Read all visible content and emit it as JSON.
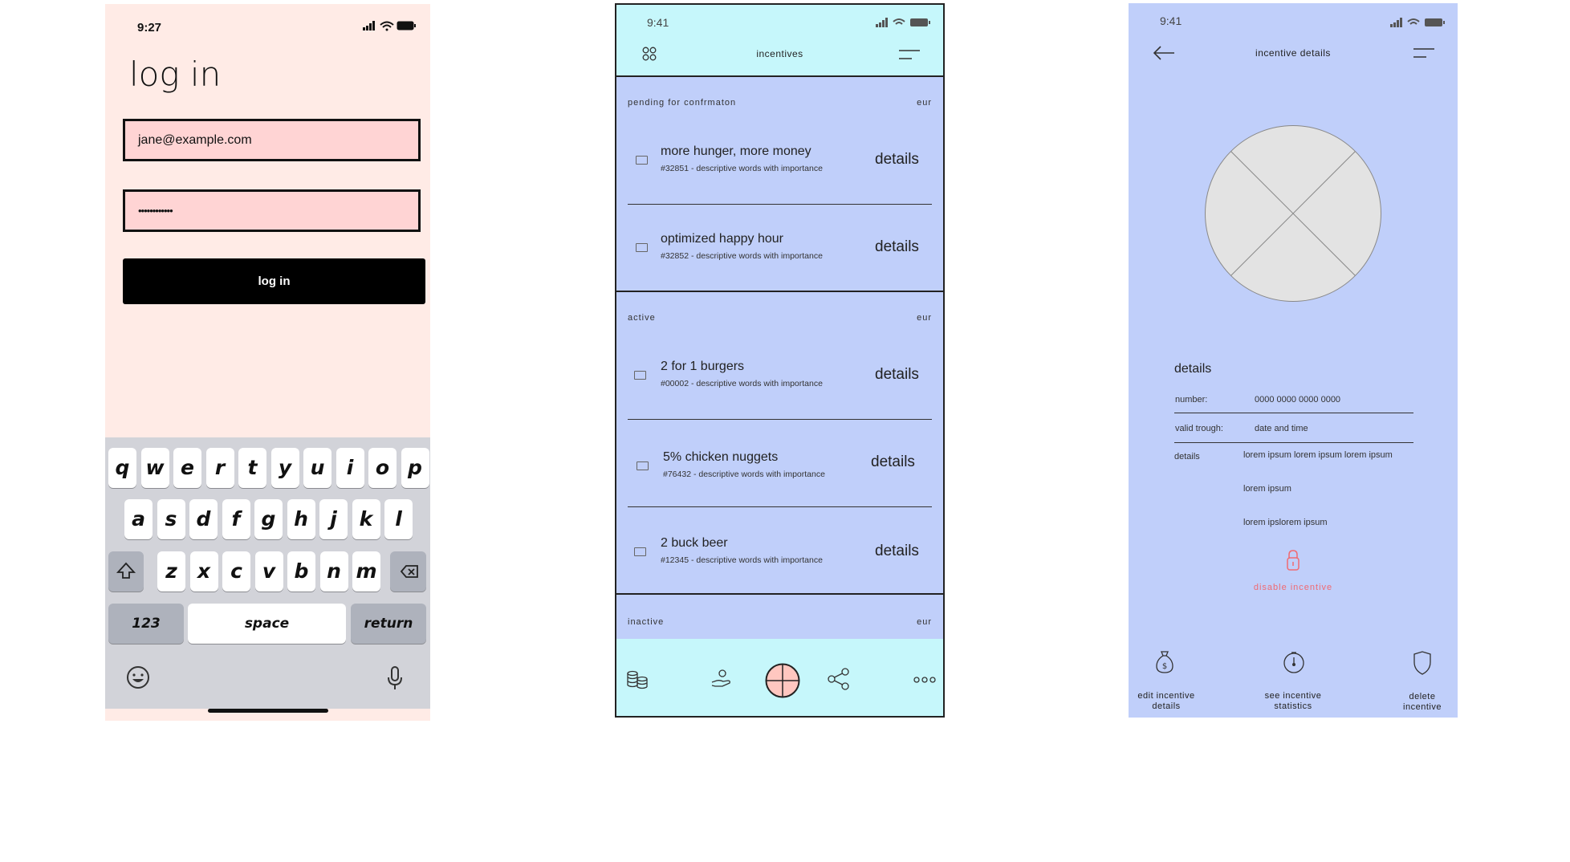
{
  "login": {
    "status_time": "9:27",
    "title": "log in",
    "email_value": "jane@example.com",
    "password_value": "••••••••••••",
    "login_button": "log in",
    "keyboard": {
      "row1": [
        "q",
        "w",
        "e",
        "r",
        "t",
        "y",
        "u",
        "i",
        "o",
        "p"
      ],
      "row2": [
        "a",
        "s",
        "d",
        "f",
        "g",
        "h",
        "j",
        "k",
        "l"
      ],
      "row3": [
        "z",
        "x",
        "c",
        "v",
        "b",
        "n",
        "m"
      ],
      "numbers_key": "123",
      "space_key": "space",
      "return_key": "return"
    }
  },
  "incentives": {
    "status_time": "9:41",
    "title": "incentives",
    "sections": [
      {
        "label": "pending for confrmaton",
        "currency": "eur",
        "items": [
          {
            "title": "more hunger, more money",
            "subtitle": "#32851 - descriptive words with importance",
            "action": "details"
          },
          {
            "title": "optimized happy hour",
            "subtitle": "#32852 - descriptive words with importance",
            "action": "details"
          }
        ]
      },
      {
        "label": "active",
        "currency": "eur",
        "items": [
          {
            "title": "2 for 1 burgers",
            "subtitle": "#00002 - descriptive words with importance",
            "action": "details"
          },
          {
            "title": "5% chicken nuggets",
            "subtitle": "#76432 - descriptive words with importance",
            "action": "details"
          },
          {
            "title": "2 buck beer",
            "subtitle": "#12345 - descriptive words with importance",
            "action": "details"
          }
        ]
      },
      {
        "label": "inactive",
        "currency": "eur",
        "items": []
      }
    ],
    "footer_icons": [
      "coins-icon",
      "hand-icon",
      "crosshair-icon",
      "share-icon",
      "more-icon"
    ]
  },
  "detail": {
    "status_time": "9:41",
    "title": "incentive details",
    "section_title": "details",
    "number_label": "number:",
    "number_value": "0000 0000 0000 0000",
    "valid_label": "valid trough:",
    "valid_value": "date and time",
    "details_label": "details",
    "details_lines": [
      "lorem ipsum lorem ipsum lorem ipsum",
      "lorem ipsum",
      "lorem ipslorem ipsum"
    ],
    "disable_label": "disable incentive",
    "actions": [
      {
        "label": "edit incentive details",
        "icon": "money-bag-icon"
      },
      {
        "label": "see incentive statistics",
        "icon": "stopwatch-icon"
      },
      {
        "label": "delete incentive",
        "icon": "shield-icon"
      }
    ],
    "accent_color": "#f06a72"
  },
  "colors": {
    "login_bg": "#ffebe6",
    "field_bg": "#ffd4d4",
    "header_cyan": "#c6f7fb",
    "panel_blue": "#c0cffa"
  }
}
